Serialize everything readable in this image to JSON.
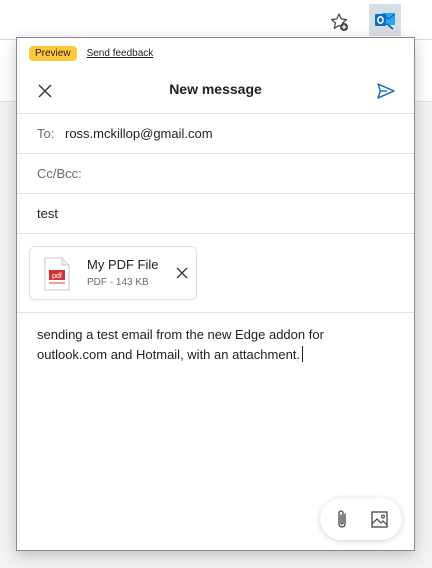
{
  "toolbar": {
    "favorite_icon": "star-plus-icon",
    "extension_icon": "outlook-icon",
    "extension_color": "#0f6cbd"
  },
  "popup": {
    "preview_badge": "Preview",
    "feedback_link": "Send feedback",
    "title": "New message",
    "accent_color": "#0f6cbd",
    "badge_color": "#ffc83d"
  },
  "fields": {
    "to_label": "To:",
    "to_value": "ross.mckillop@gmail.com",
    "cc_label": "Cc/Bcc:",
    "subject_value": "test"
  },
  "attachment": {
    "name": "My PDF File",
    "meta": "PDF - 143 KB",
    "icon": "pdf-file-icon"
  },
  "body": {
    "text": "sending a test email from the new Edge addon for outlook.com and Hotmail, with an attachment."
  },
  "actions": {
    "attach_icon": "paperclip-icon",
    "image_icon": "insert-image-icon"
  }
}
